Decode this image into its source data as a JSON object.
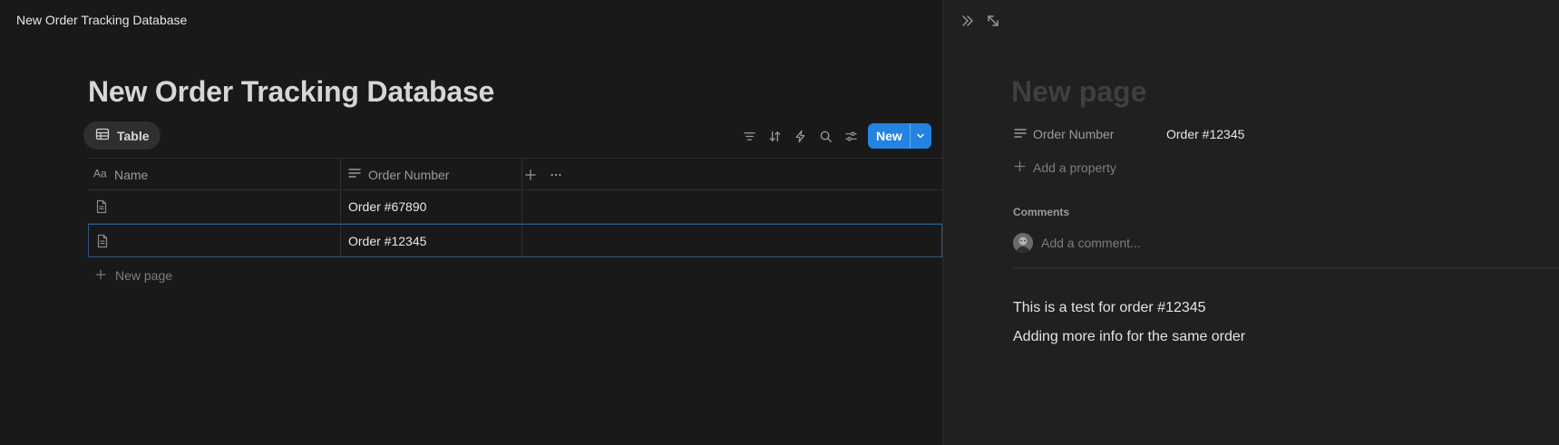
{
  "app": {
    "topbar_title": "New Order Tracking Database"
  },
  "database": {
    "title": "New Order Tracking Database",
    "view_tab": {
      "label": "Table",
      "icon": "table-icon"
    },
    "toolbar": {
      "icons": [
        "filter-icon",
        "sort-icon",
        "automation-icon",
        "search-icon",
        "settings-sliders-icon"
      ],
      "new_label": "New"
    },
    "columns": [
      {
        "label": "Name",
        "icon": "text-aa-icon"
      },
      {
        "label": "Order Number",
        "icon": "text-lines-icon"
      }
    ],
    "rows": [
      {
        "name": "",
        "order_number": "Order #67890"
      },
      {
        "name": "",
        "order_number": "Order #12345"
      }
    ],
    "new_page_label": "New page"
  },
  "peek": {
    "title_placeholder": "New page",
    "property": {
      "label": "Order Number",
      "value": "Order #12345"
    },
    "add_property_label": "Add a property",
    "comments_label": "Comments",
    "comment_placeholder": "Add a comment...",
    "body_lines": [
      "This is a test for order #12345",
      "Adding more info for the same order"
    ]
  },
  "colors": {
    "background": "#191919",
    "peek_background": "#202020",
    "accent": "#2383e2",
    "selected_row_border": "#2b5a8a"
  }
}
